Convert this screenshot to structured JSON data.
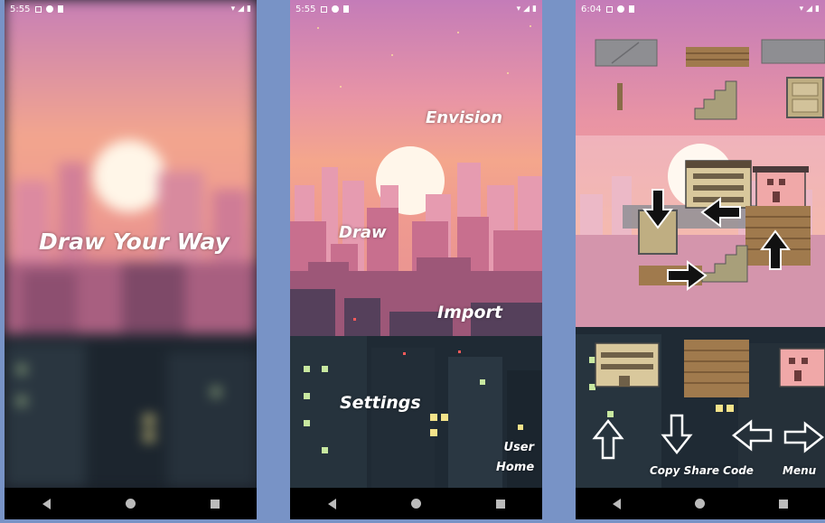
{
  "screens": [
    {
      "status": {
        "time": "5:55"
      },
      "title": "Draw Your Way"
    },
    {
      "status": {
        "time": "5:55"
      },
      "menu": {
        "envision": "Envision",
        "draw": "Draw",
        "import": "Import",
        "settings": "Settings",
        "user_home_line1": "User",
        "user_home_line2": "Home"
      }
    },
    {
      "status": {
        "time": "6:04"
      },
      "toolbar": {
        "copy_share_code": "Copy Share Code",
        "menu": "Menu"
      }
    }
  ],
  "colors": {
    "sky_top": "#c77fb6",
    "sky_mid": "#f2a58e",
    "sky_low": "#e88e8f",
    "city_far": "#d9879b",
    "city_mid": "#b86b85",
    "city_near": "#6b4a6c",
    "city_dark": "#2b3440",
    "window_yellow": "#f4e38a",
    "window_green": "#c8e8a0",
    "brick": "#a07a4d",
    "page_bg": "#7893c6"
  }
}
